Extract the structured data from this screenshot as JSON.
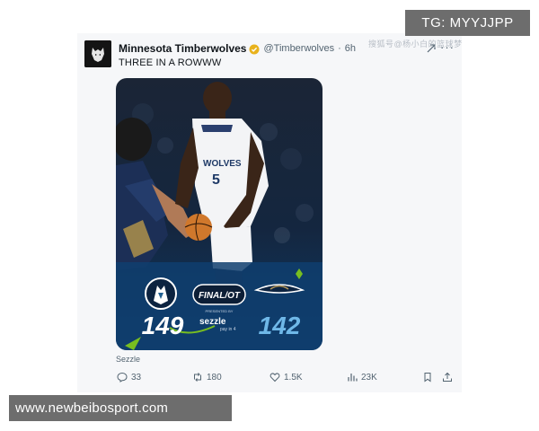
{
  "tweet": {
    "display_name": "Minnesota Timberwolves",
    "handle": "@Timberwolves",
    "separator": "·",
    "time": "6h",
    "text": "THREE IN A ROWWW",
    "media_caption": "Sezzle",
    "more_label": "···",
    "verified_icon": "verified-badge-icon",
    "colors": {
      "verified": "#e8b21c",
      "text": "#0f1419",
      "muted": "#536471",
      "card_bg": "#f6f7f9"
    }
  },
  "media": {
    "team_home_logo": "timberwolves-logo",
    "team_away_logo": "pelicans-logo",
    "status": "FINAL/OT",
    "presented_by": "PRESENTED BY",
    "sponsor": "sezzle",
    "sponsor_tagline": "pay in 4",
    "home_score": "149",
    "away_score": "142",
    "jersey_text": "WOLVES",
    "jersey_number": "5",
    "colors": {
      "bg_dark": "#0f1e33",
      "bg_navy": "#123a63",
      "score_white": "#ffffff",
      "score_blue": "#6fb8e8",
      "accent_green": "#78be20",
      "jersey": "#f3f4f6"
    }
  },
  "actions": [
    {
      "icon": "reply-icon",
      "count": "33"
    },
    {
      "icon": "retweet-icon",
      "count": "180"
    },
    {
      "icon": "like-icon",
      "count": "1.5K"
    },
    {
      "icon": "views-icon",
      "count": "23K"
    },
    {
      "icon": "bookmark-icon",
      "count": ""
    },
    {
      "icon": "share-icon",
      "count": ""
    }
  ],
  "watermarks": {
    "tg_badge": "TG: MYYJJPP",
    "site": "www.newbeibosport.com",
    "cn_mark": "搜狐号@杨小白的篮球梦"
  }
}
